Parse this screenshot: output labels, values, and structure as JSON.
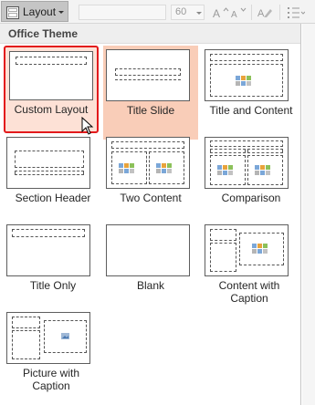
{
  "ribbon": {
    "layout_label": "Layout",
    "font_size": "60"
  },
  "gallery": {
    "header": "Office Theme",
    "layouts": [
      {
        "label": "Custom Layout"
      },
      {
        "label": "Title Slide"
      },
      {
        "label": "Title and Content"
      },
      {
        "label": "Section Header"
      },
      {
        "label": "Two Content"
      },
      {
        "label": "Comparison"
      },
      {
        "label": "Title Only"
      },
      {
        "label": "Blank"
      },
      {
        "label": "Content with Caption"
      },
      {
        "label": "Picture with Caption"
      }
    ]
  },
  "state": {
    "selected_layout": "Custom Layout",
    "hovered_layout": "Title Slide"
  },
  "colors": {
    "selection_border": "#e31a1c",
    "hover_fill": "#f9cdb8"
  }
}
